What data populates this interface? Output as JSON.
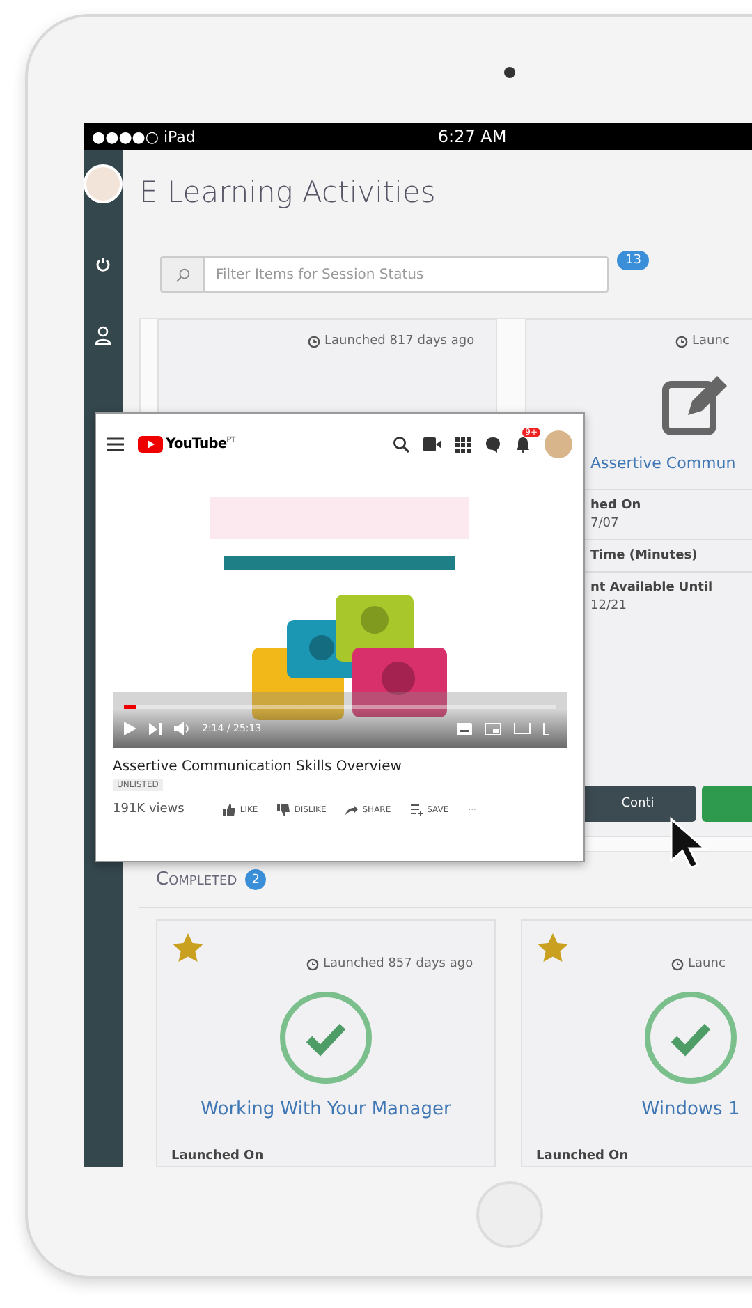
{
  "status_bar": {
    "carrier": "●●●●○ iPad",
    "time": "6:27 AM"
  },
  "page": {
    "title": "E Learning Activities"
  },
  "filter": {
    "placeholder": "Filter Items for Session Status",
    "count": "13"
  },
  "in_progress": [
    {
      "launched": "Launched 817 days ago",
      "kind": "blank"
    },
    {
      "launched": "Launc",
      "kind": "edit",
      "title": "Assertive Commun",
      "fields": [
        {
          "label": "hed On",
          "value": "7/07"
        },
        {
          "label": "Time (Minutes)"
        },
        {
          "label": "nt Available Until",
          "value": "12/21"
        }
      ],
      "buttons": [
        {
          "label": "Conti",
          "kind": "dark"
        },
        {
          "kind": "green"
        }
      ]
    }
  ],
  "completed": {
    "label": "Completed",
    "count": "2",
    "cards": [
      {
        "starred": true,
        "launched": "Launched 857 days ago",
        "title": "Working With Your Manager",
        "field": "Launched On"
      },
      {
        "starred": true,
        "launched": "Launc",
        "title": "Windows 1",
        "field": "Launched On"
      }
    ]
  },
  "video_popup": {
    "logo": "YouTube",
    "logo_suffix": "PT",
    "notifications": "9+",
    "video": {
      "kind": "picture",
      "level": 0.03,
      "time": "2:14 / 25:13"
    },
    "title": "Assertive Communication Skills Overview",
    "tag": "UNLISTED",
    "views": "191K views",
    "actions": [
      "LIKE",
      "DISLIKE",
      "SHARE",
      "SAVE",
      "···"
    ]
  }
}
